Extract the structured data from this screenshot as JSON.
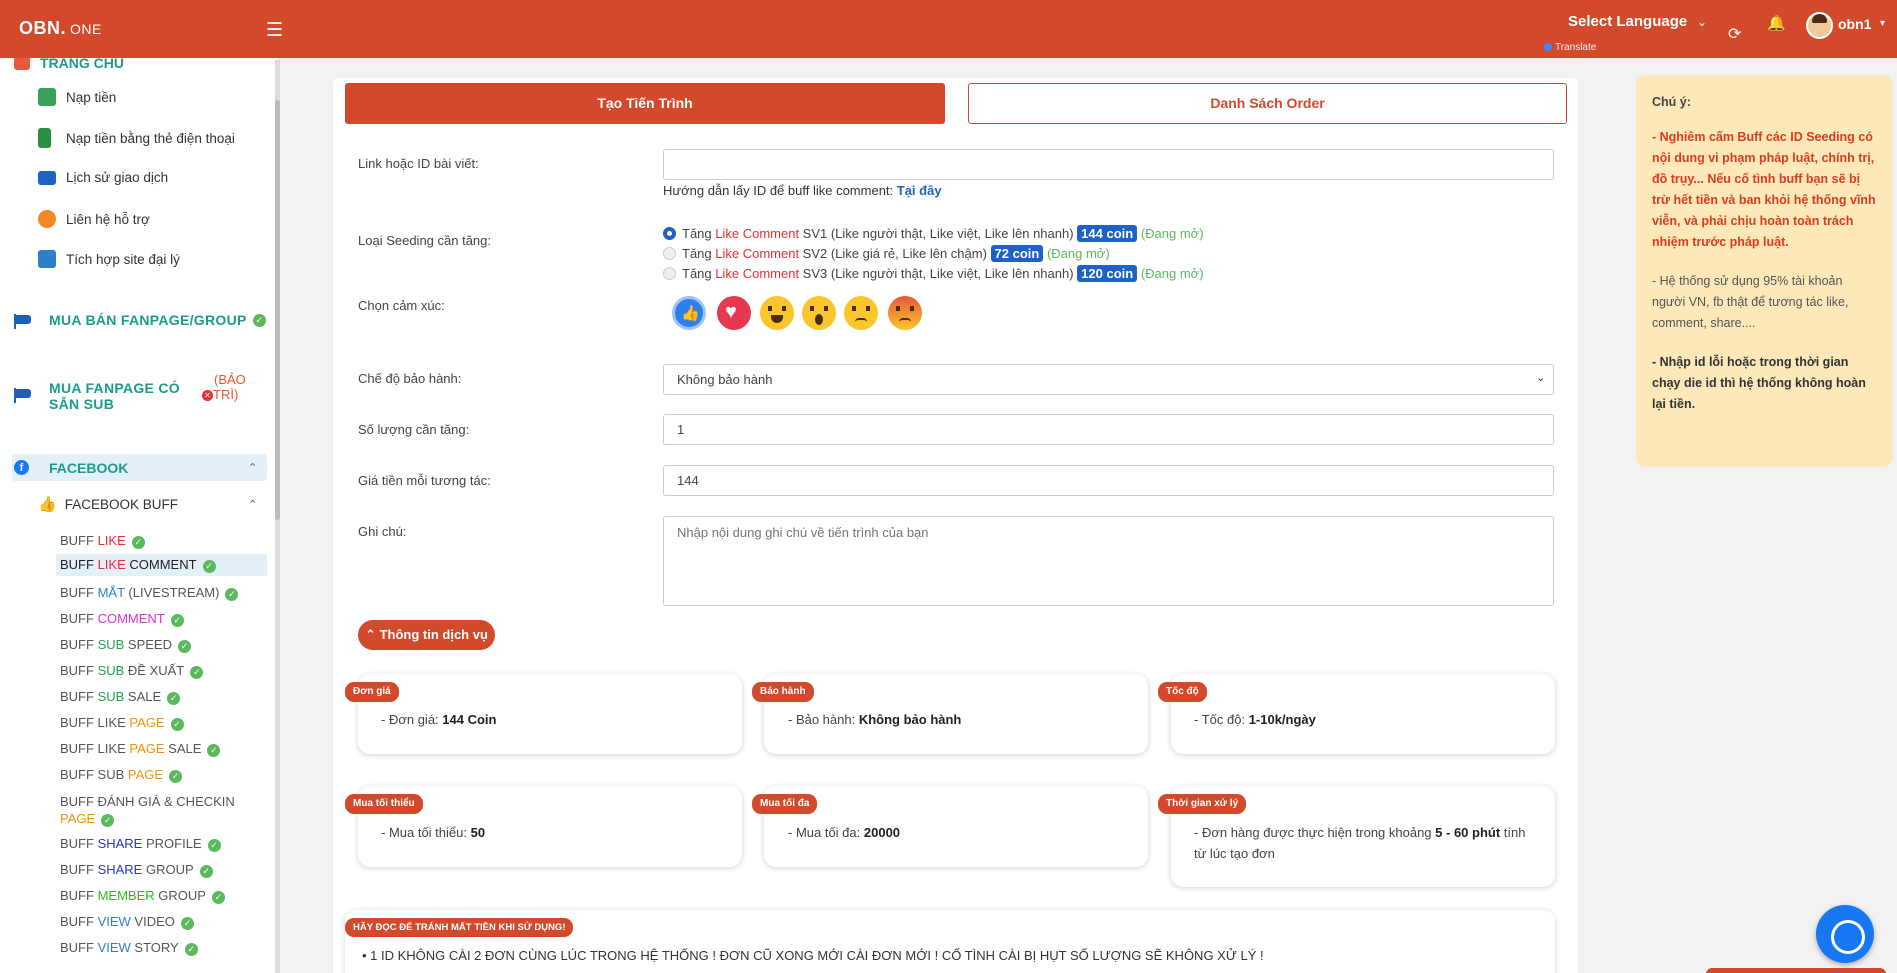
{
  "header": {
    "brand": "OBN.",
    "brand_suffix": "ONE",
    "language": "Select Language",
    "translate": "Translate",
    "username": "obn1"
  },
  "sidebar": {
    "home": "TRANG CHỦ",
    "items": [
      {
        "label": "Nạp tiền",
        "icon": "money-icon",
        "color": "#3aa15a"
      },
      {
        "label": "Nạp tiền bằng thẻ điện thoại",
        "icon": "card-icon",
        "color": "#2c8f46"
      },
      {
        "label": "Lịch sử giao dịch",
        "icon": "chart-icon",
        "color": "#1e63c4"
      },
      {
        "label": "Liên hệ hỗ trợ",
        "icon": "support-icon",
        "color": "#f08a24",
        "badge": "0"
      },
      {
        "label": "Tích hợp site đại lý",
        "icon": "store-icon",
        "color": "#2f80c9"
      }
    ],
    "section_fanpage": "MUA BÁN FANPAGE/GROUP",
    "section_fanpage_sub_l1": "MUA FANPAGE CÓ",
    "section_fanpage_sub_l2": "SẴN SUB",
    "baotri_l1": "(BẢO",
    "baotri_l2": "TRÌ)",
    "facebook": "FACEBOOK",
    "facebook_buff": "FACEBOOK BUFF",
    "buff": {
      "b1a": "BUFF ",
      "b1b": "LIKE",
      "b2a": "BUFF ",
      "b2b": "LIKE",
      "b2c": " COMMENT",
      "b3a": "BUFF ",
      "b3b": "MẮT",
      "b3c": " (LIVESTREAM)",
      "b4a": "BUFF ",
      "b4b": "COMMENT",
      "b5a": "BUFF ",
      "b5b": "SUB",
      "b5c": " SPEED",
      "b6a": "BUFF ",
      "b6b": "SUB",
      "b6c": " ĐỀ XUẤT",
      "b7a": "BUFF ",
      "b7b": "SUB",
      "b7c": " SALE",
      "b8a": "BUFF LIKE ",
      "b8b": "PAGE",
      "b9a": "BUFF LIKE ",
      "b9b": "PAGE",
      "b9c": " SALE",
      "b10a": "BUFF SUB ",
      "b10b": "PAGE",
      "b11a": "BUFF ĐÁNH GIÁ & CHECKIN",
      "b11b": "PAGE",
      "b12a": "BUFF ",
      "b12b": "SHARE",
      "b12c": " PROFILE",
      "b13a": "BUFF ",
      "b13b": "SHARE",
      "b13c": " GROUP",
      "b14a": "BUFF ",
      "b14b": "MEMBER",
      "b14c": " GROUP",
      "b15a": "BUFF ",
      "b15b": "VIEW",
      "b15c": " VIDEO",
      "b16a": "BUFF ",
      "b16b": "VIEW",
      "b16c": " STORY"
    }
  },
  "tabs": {
    "create": "Tạo Tiến Trình",
    "orders": "Danh Sách Order"
  },
  "form": {
    "link_label": "Link hoặc ID bài viết:",
    "hint": "Hướng dẫn lấy ID để buff like comment: ",
    "hint_link": "Tại đây",
    "seeding_label": "Loại Seeding cần tăng:",
    "options": [
      {
        "pre": "Tăng ",
        "kw": "Like Comment",
        "name": " SV1 (Like người thật, Like việt, Like lên nhanh) ",
        "coin": "144 coin",
        "status": " (Đang mở)"
      },
      {
        "pre": "Tăng ",
        "kw": "Like Comment",
        "name": " SV2 (Like giá rẻ, Like lên chậm) ",
        "coin": "72 coin",
        "status": " (Đang mở)"
      },
      {
        "pre": "Tăng ",
        "kw": "Like Comment",
        "name": " SV3 (Like người thật, Like việt, Like lên nhanh) ",
        "coin": "120 coin",
        "status": " (Đang mở)"
      }
    ],
    "emotion_label": "Chọn cảm xúc:",
    "warranty_label": "Chế độ bảo hành:",
    "warranty_value": "Không bảo hành",
    "qty_label": "Số lượng cần tăng:",
    "qty_value": "1",
    "price_label": "Giá tiền mỗi tương tác:",
    "price_value": "144",
    "note_label": "Ghi chú:",
    "note_placeholder": "Nhập nội dung ghi chú về tiến trình của bạn",
    "info_button": "⌃ Thông tin dịch vụ"
  },
  "info": {
    "price_tag": "Đơn giá",
    "price_text": "- Đơn giá: ",
    "price_val": "144 Coin",
    "warranty_tag": "Bảo hành",
    "warranty_text": "- Bảo hành: ",
    "warranty_val": "Không bảo hành",
    "speed_tag": "Tốc độ",
    "speed_text": "- Tốc độ: ",
    "speed_val": "1-10k/ngày",
    "min_tag": "Mua tối thiểu",
    "min_text": "- Mua tối thiểu: ",
    "min_val": "50",
    "max_tag": "Mua tối đa",
    "max_text": "- Mua tối đa: ",
    "max_val": "20000",
    "time_tag": "Thời gian xử lý",
    "time_text": "- Đơn hàng được thực hiện trong khoảng ",
    "time_val": "5 - 60 phút",
    "time_text2": " tính",
    "time_text3": "từ lúc tạo đơn"
  },
  "warning": {
    "tag": "HÃY ĐỌC ĐỂ TRÁNH MẤT TIỀN KHI SỬ DỤNG!",
    "line1": "• 1 ID KHÔNG CÀI 2 ĐƠN CÙNG LÚC TRONG HỆ THỐNG ! ĐƠN CŨ XONG MỚI CÀI ĐƠN MỚI ! CỐ TÌNH CÀI BỊ HỤT SỐ LƯỢNG SẼ KHÔNG XỬ LÝ !"
  },
  "note": {
    "title": "Chú ý:",
    "red": "- Nghiêm cấm Buff các ID Seeding có nội dung vi phạm pháp luật, chính trị, đồ trụy... Nếu cố tình buff bạn sẽ bị trừ hết tiền và ban khỏi hệ thống vĩnh viễn, và phải chịu hoàn toàn trách nhiệm trước pháp luật.",
    "gray": "- Hệ thống sử dụng 95% tài khoản người VN, fb thật để tương tác like, comment, share....",
    "bold": "- Nhập id lỗi hoặc trong thời gian chạy die id thì hệ thống không hoàn lại tiền."
  }
}
